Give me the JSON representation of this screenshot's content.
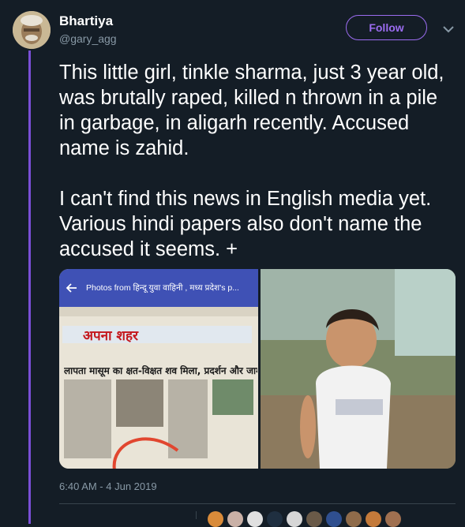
{
  "tweet": {
    "display_name": "Bhartiya",
    "handle": "@gary_agg",
    "follow_label": "Follow",
    "text": "This little girl,  tinkle sharma,  just 3 year old,  was brutally raped,  killed n thrown in a pile in garbage,  in aligarh recently. Accused name is zahid.\n\nI can't find this news in English media yet.  Various hindi papers also don't name the accused it seems.  +",
    "timestamp": "6:40 AM - 4 Jun 2019"
  },
  "media": {
    "viewer_title": "Photos from हिन्दू युवा वाहिनी , मध्य प्रदेश's p...",
    "masthead": "अपना शहर",
    "headline": "लापता मासूम का क्षत-विक्षत शव मिला, प्रदर्शन और जाम"
  },
  "colors": {
    "background": "#141d26",
    "accent": "#9b6cf0",
    "thread_line": "#7a4fd6",
    "muted": "#8899a6"
  },
  "icons": {
    "caret": "chevron-down-icon",
    "back": "arrow-left-icon"
  }
}
